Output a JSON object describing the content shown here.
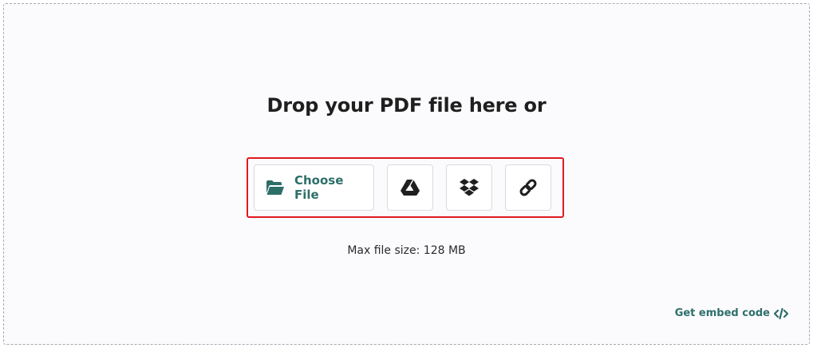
{
  "dropzone": {
    "title": "Drop your PDF file here or",
    "max_size": "Max file size: 128 MB"
  },
  "buttons": {
    "choose_file": {
      "label": "Choose File",
      "icon": "folder-open-icon"
    },
    "google_drive": {
      "icon": "google-drive-icon"
    },
    "dropbox": {
      "icon": "dropbox-icon"
    },
    "url": {
      "icon": "link-icon"
    }
  },
  "embed": {
    "label": "Get embed code",
    "icon": "code-icon"
  },
  "colors": {
    "accent": "#2e6e69",
    "highlight": "#e0191f",
    "background": "#fbfbfe"
  }
}
